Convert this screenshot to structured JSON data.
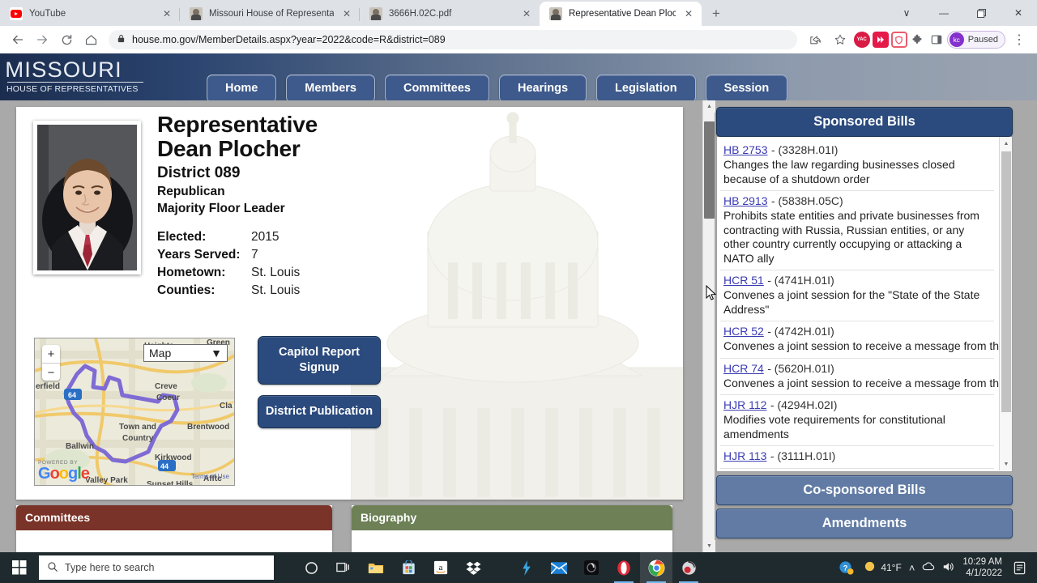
{
  "browser": {
    "tabs": [
      {
        "title": "YouTube",
        "favicon": "youtube-icon",
        "active": false
      },
      {
        "title": "Missouri House of Representativ",
        "favicon": "missouri-icon",
        "active": false
      },
      {
        "title": "3666H.02C.pdf",
        "favicon": "pdf-icon",
        "active": false
      },
      {
        "title": "Representative Dean Plocher",
        "favicon": "missouri-icon",
        "active": true
      }
    ],
    "new_tab_label": "+",
    "window_controls": {
      "minimize": "—",
      "maximize": "❐",
      "close": "✕",
      "tab_search": "∨"
    },
    "nav": {
      "back": "←",
      "forward": "→",
      "reload": "⟳",
      "home": "⌂"
    },
    "omnibox": {
      "lock_icon": "lock-icon",
      "url": "house.mo.gov/MemberDetails.aspx?year=2022&code=R&district=089",
      "share_icon": "share-icon",
      "bookmark_icon": "star-icon"
    },
    "extensions": [
      {
        "name": "yac-extension",
        "label": "YAC"
      },
      {
        "name": "fast-forward-extension",
        "label": "»"
      },
      {
        "name": "shield-extension",
        "label": ""
      },
      {
        "name": "puzzle-extensions-icon",
        "label": "🧩"
      },
      {
        "name": "side-panel-icon",
        "label": "▣"
      }
    ],
    "profile": {
      "initials": "kc",
      "status": "Paused"
    },
    "menu_icon": "⋮"
  },
  "site": {
    "logo": {
      "line1": "MISSOURI",
      "line2": "HOUSE OF REPRESENTATIVES"
    },
    "nav_items": [
      "Home",
      "Members",
      "Committees",
      "Hearings",
      "Legislation",
      "Session"
    ]
  },
  "member": {
    "title": "Representative",
    "name": "Dean Plocher",
    "district": "District 089",
    "party": "Republican",
    "role": "Majority Floor Leader",
    "facts": [
      {
        "label": "Elected:",
        "value": "2015"
      },
      {
        "label": "Years Served:",
        "value": "7"
      },
      {
        "label": "Hometown:",
        "value": "St. Louis"
      },
      {
        "label": "Counties:",
        "value": "St. Louis"
      }
    ],
    "photo_alt": "member-photo"
  },
  "map": {
    "type_selector": "Map",
    "zoom_in": "+",
    "zoom_out": "−",
    "place_labels": [
      "Heights",
      "Creve",
      "Coeur",
      "Cla",
      "Brentwood",
      "Town and",
      "Country",
      "Ballwin",
      "Kirkwood",
      "Valley Park",
      "Sunset Hills",
      "Affto",
      "erfield"
    ],
    "attribution_powered": "POWERED BY",
    "attribution_brand": "Google",
    "attribution_terms": "Terms of Use"
  },
  "actions": {
    "capitol_report": "Capitol Report Signup",
    "district_publication": "District Publication"
  },
  "panels": {
    "committees_title": "Committees",
    "biography_title": "Biography"
  },
  "right_column": {
    "sponsored_title": "Sponsored Bills",
    "cosponsored_title": "Co-sponsored Bills",
    "amendments_title": "Amendments",
    "bills": [
      {
        "number": "HB 2753",
        "version": "- (3328H.01I)",
        "description": "Changes the law regarding businesses closed because of a shutdown order",
        "wrap": true
      },
      {
        "number": "HB 2913",
        "version": "- (5838H.05C)",
        "description": "Prohibits state entities and private businesses from contracting with Russia, Russian entities, or any other country currently occupying or attacking a NATO ally",
        "wrap": true
      },
      {
        "number": "HCR 51",
        "version": "- (4741H.01I)",
        "description": "Convenes a joint session for the \"State of the State Address\"",
        "wrap": true
      },
      {
        "number": "HCR 52",
        "version": "- (4742H.01I)",
        "description": "Convenes a joint session to receive a message from the Chief Justice of the Missouri Supreme Court",
        "wrap": true
      },
      {
        "number": "HCR 74",
        "version": "- (5620H.01I)",
        "description": "Convenes a joint session to receive a message from the Chief Justice of the Missouri Supreme Court",
        "wrap": true
      },
      {
        "number": "HJR 112",
        "version": "- (4294H.02I)",
        "description": "Modifies vote requirements for constitutional amendments",
        "wrap": true
      },
      {
        "number": "HJR 113",
        "version": "- (3111H.01I)",
        "description": "",
        "wrap": true
      }
    ]
  },
  "taskbar": {
    "start_icon": "windows-start-icon",
    "search_placeholder": "Type here to search",
    "search_icon": "search-icon",
    "apps": [
      {
        "name": "cortana-icon",
        "glyph": "○"
      },
      {
        "name": "task-view-icon",
        "glyph": "☰"
      },
      {
        "name": "file-explorer-icon",
        "glyph": "📁"
      },
      {
        "name": "microsoft-store-icon",
        "glyph": "🛍"
      },
      {
        "name": "amazon-icon",
        "glyph": "a"
      },
      {
        "name": "dropbox-icon",
        "glyph": "❖"
      },
      {
        "name": "lightning-app-icon",
        "glyph": "⚡"
      },
      {
        "name": "mail-icon",
        "glyph": "✉"
      },
      {
        "name": "dark-app-icon",
        "glyph": "◑"
      },
      {
        "name": "opera-icon",
        "glyph": "O"
      },
      {
        "name": "chrome-icon",
        "glyph": "◯"
      },
      {
        "name": "obs-icon",
        "glyph": "●"
      }
    ],
    "tray": {
      "help_icon": "help-icon",
      "weather_icon": "sun-icon",
      "temperature": "41°F",
      "chevron": "˄",
      "onedrive_icon": "onedrive-icon",
      "volume_icon": "volume-icon",
      "time": "10:29 AM",
      "date": "4/1/2022",
      "notification_icon": "notification-icon"
    }
  },
  "colors": {
    "brand_blue": "#2b4a7d",
    "nav_blue": "#3e5a8c",
    "panel_blue": "#617ba4",
    "committees_red": "#7a3328",
    "biography_green": "#6d8056",
    "link_blue": "#3b3bb3",
    "taskbar": "#1f2a2e"
  }
}
